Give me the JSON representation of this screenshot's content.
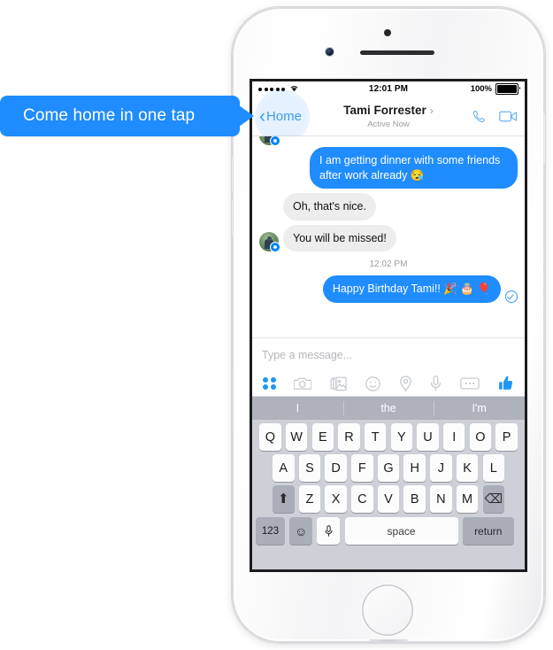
{
  "callout": {
    "text": "Come home in one tap",
    "color": "#1f8cff"
  },
  "phone": {
    "device": "iPhone 6 Silver",
    "home_button_name": "home-button"
  },
  "status_bar": {
    "signal_dots": 5,
    "wifi_icon": "wifi-icon",
    "time": "12:01 PM",
    "battery_percent": "100%",
    "battery_icon": "battery-full-icon"
  },
  "nav": {
    "back_label": "Home",
    "back_chevron": "chevron-left-icon",
    "contact_name": "Tami Forrester",
    "name_arrow": "›",
    "status": "Active Now",
    "call_icon": "phone-call-icon",
    "video_icon": "video-camera-icon"
  },
  "thread": {
    "messages": [
      {
        "id": 0,
        "side": "out",
        "text": "I am getting dinner with some friends after work already 😪"
      },
      {
        "id": 1,
        "side": "in",
        "text": "Oh, that's nice.",
        "avatar": false
      },
      {
        "id": 2,
        "side": "in",
        "text": "You will be missed!",
        "avatar": true
      }
    ],
    "timestamp": "12:02 PM",
    "last_message": {
      "side": "out",
      "text": "Happy Birthday Tami!! 🎉 🎂 🎈",
      "receipt_icon": "delivered-check-icon"
    }
  },
  "composer": {
    "placeholder": "Type a message...",
    "value": ""
  },
  "iconbar": {
    "items": [
      {
        "name": "apps-grid-icon",
        "label": "Apps"
      },
      {
        "name": "camera-icon",
        "label": "Camera"
      },
      {
        "name": "photos-icon",
        "label": "Photos"
      },
      {
        "name": "sticker-icon",
        "label": "Stickers"
      },
      {
        "name": "location-pin-icon",
        "label": "Location"
      },
      {
        "name": "microphone-icon",
        "label": "Voice"
      },
      {
        "name": "more-dots-icon",
        "label": "More"
      },
      {
        "name": "thumbs-up-icon",
        "label": "Like"
      }
    ],
    "accent": "#2196f3"
  },
  "keyboard": {
    "predictions": [
      "I",
      "the",
      "I'm"
    ],
    "row1": [
      "Q",
      "W",
      "E",
      "R",
      "T",
      "Y",
      "U",
      "I",
      "O",
      "P"
    ],
    "row2": [
      "A",
      "S",
      "D",
      "F",
      "G",
      "H",
      "J",
      "K",
      "L"
    ],
    "row3": [
      "Z",
      "X",
      "C",
      "V",
      "B",
      "N",
      "M"
    ],
    "shift_label": "⬆",
    "backspace_label": "⌫",
    "numbers_label": "123",
    "emoji_label": "☺",
    "mic_label": "🎤",
    "space_label": "space",
    "return_label": "return"
  }
}
